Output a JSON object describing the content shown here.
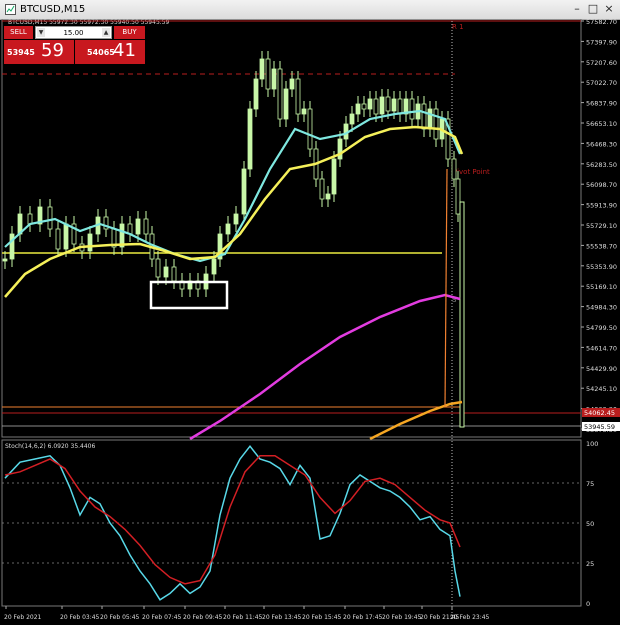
{
  "window": {
    "title": "BTCUSD,M15"
  },
  "trade_panel": {
    "sell_label": "SELL",
    "buy_label": "BUY",
    "lot": "15.00",
    "sell_price_main": "53945",
    "sell_price_big": "59",
    "buy_price_main": "54065",
    "buy_price_big": "41"
  },
  "main_chart": {
    "info": "BTCUSD,M15  55972.30 55972.30 55940.50 55945.59",
    "price_ticks": [
      "57582.70",
      "57397.90",
      "57207.60",
      "57022.70",
      "56837.90",
      "56653.10",
      "56468.30",
      "56283.50",
      "56098.70",
      "55913.90",
      "55729.10",
      "55538.70",
      "55353.90",
      "55169.10",
      "54984.30",
      "54799.50",
      "54614.70",
      "54429.90",
      "54245.10",
      "54060.30",
      "53875.50"
    ],
    "labels": {
      "r1": "R 1",
      "pivot": "Pivot Point",
      "s_marker": "S",
      "ask_price": "54062.45",
      "bid_price": "53945.59"
    },
    "colors": {
      "candle": "#c9f7a8",
      "ma_fast": "#7fe8e0",
      "ma_mid": "#f5f05a",
      "ma_slow": "#e23ce0",
      "ma_slowest": "#f5a623",
      "pivot_line": "#eaea40",
      "resistance": "#b81e1e",
      "support": "#f08030"
    }
  },
  "stoch": {
    "label": "Stoch(14,6,2) 6.0920 35.4406",
    "ticks": [
      "100",
      "75",
      "50",
      "25",
      "0"
    ],
    "colors": {
      "main": "#58d8e8",
      "signal": "#d21f24"
    }
  },
  "time_axis": [
    "20 Feb 2021",
    "20 Feb 03:45",
    "20 Feb 05:45",
    "20 Feb 07:45",
    "20 Feb 09:45",
    "20 Feb 11:45",
    "20 Feb 13:45",
    "20 Feb 15:45",
    "20 Feb 17:45",
    "20 Feb 19:45",
    "20 Feb 21:45",
    "20 Feb 23:45"
  ]
}
